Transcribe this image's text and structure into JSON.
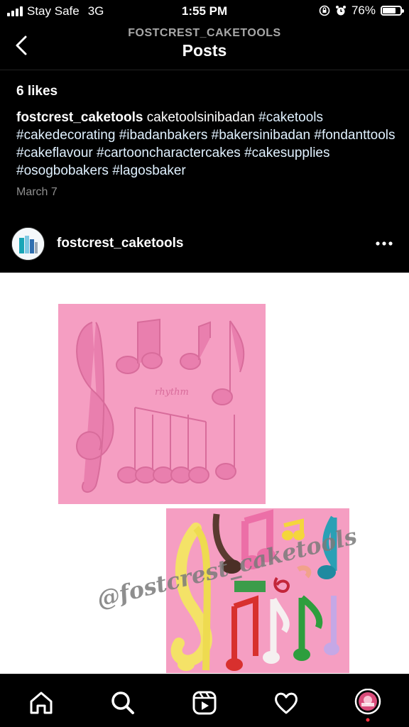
{
  "status_bar": {
    "carrier": "Stay Safe",
    "network": "3G",
    "time": "1:55 PM",
    "battery": "76%",
    "battery_level": 0.76
  },
  "header": {
    "account": "FOSTCREST_CAKETOOLS",
    "title": "Posts"
  },
  "post": {
    "likes": "6 likes",
    "caption_user": "fostcrest_caketools",
    "caption_text": "caketoolsinibadan",
    "hashtags": [
      "#caketools",
      "#cakedecorating",
      "#ibadanbakers",
      "#bakersinibadan",
      "#fondanttools",
      "#cakeflavour",
      "#cartooncharactercakes",
      "#cakesupplies",
      "#osogbobakers",
      "#lagosbaker"
    ],
    "date": "March 7"
  },
  "next_post": {
    "username": "fostcrest_caketools",
    "watermark": "@fostcrest_caketools",
    "mold_label": "rhythm"
  },
  "tab_bar": {
    "items": [
      "home-icon",
      "search-icon",
      "reels-icon",
      "heart-icon",
      "profile-avatar"
    ]
  },
  "colors": {
    "mold_pink": "#f59ec2",
    "background": "#000000",
    "hashtag": "#e0f1ff",
    "notification_dot": "#ff3040"
  }
}
